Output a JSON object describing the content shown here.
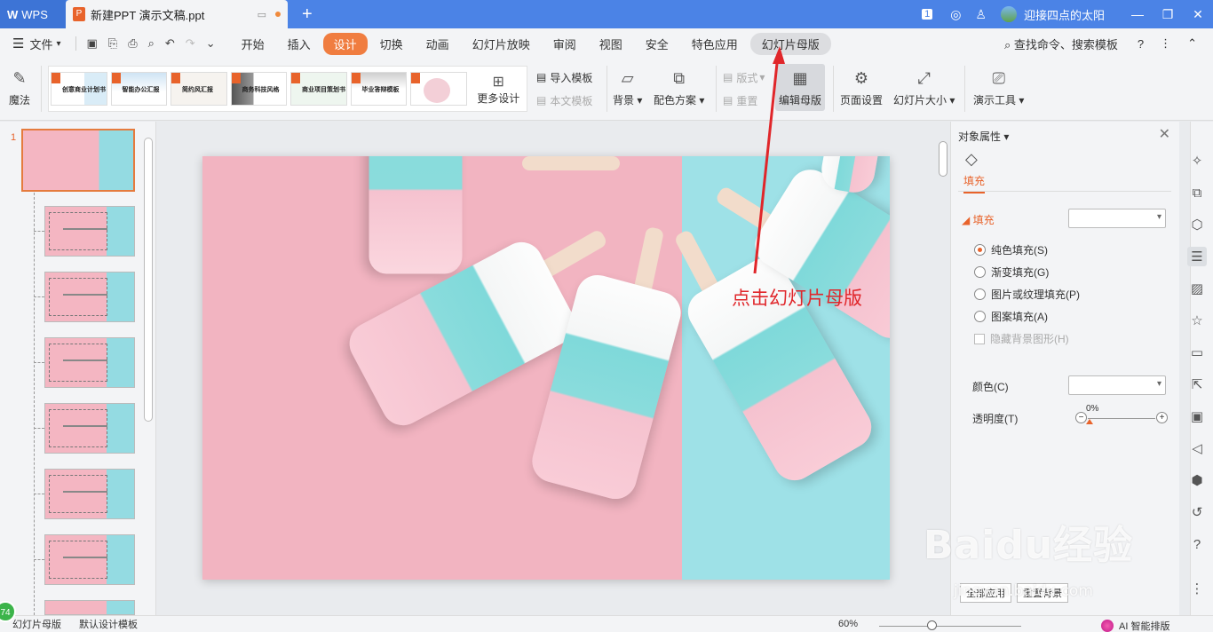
{
  "titlebar": {
    "app_name": "WPS",
    "doc_tab": "新建PPT 演示文稿.ppt",
    "new_tab": "+",
    "window_count": "1",
    "user_name": "迎接四点的太阳"
  },
  "menubar": {
    "file": "文件",
    "tabs": [
      "开始",
      "插入",
      "设计",
      "切换",
      "动画",
      "幻灯片放映",
      "审阅",
      "视图",
      "安全",
      "特色应用",
      "幻灯片母版"
    ],
    "active_tab": "设计",
    "search": "查找命令、搜索模板"
  },
  "ribbon": {
    "magic": "魔法",
    "templates": [
      "创意商业计划书",
      "智能办公汇报",
      "简约风汇报",
      "商务科技风格",
      "商业项目策划书",
      "毕业答辩模板"
    ],
    "more_design": "更多设计",
    "import_template": "导入模板",
    "this_template": "本文模板",
    "background": "背景",
    "color_scheme": "配色方案",
    "layout": "版式",
    "reset": "重置",
    "edit_master": "编辑母版",
    "page_setup": "页面设置",
    "slide_size": "幻灯片大小",
    "present_tools": "演示工具"
  },
  "thumbnails": {
    "slide_number": "1"
  },
  "canvas": {
    "annotation": "点击幻灯片母版"
  },
  "panel": {
    "title": "对象属性",
    "tab_fill": "填充",
    "section_fill": "填充",
    "options": [
      "纯色填充(S)",
      "渐变填充(G)",
      "图片或纹理填充(P)",
      "图案填充(A)"
    ],
    "selected_option": "纯色填充(S)",
    "hide_bg": "隐藏背景图形(H)",
    "color_label": "颜色(C)",
    "transparency_label": "透明度(T)",
    "transparency_value": "0%",
    "apply_all": "全部应用",
    "reset_bg": "重置背景"
  },
  "statusbar": {
    "left1": "幻灯片母版",
    "left2": "默认设计模板",
    "zoom": "60%",
    "ai": "AI 智能排版",
    "badge": "74"
  },
  "watermark": {
    "brand": "Baidu经验",
    "url": "jingyan.baidu.com"
  },
  "colors": {
    "accent": "#e8632b",
    "title_bar": "#4b83e6",
    "annotation": "#e0262a",
    "slide_pink": "#f2b4c1",
    "slide_blue": "#9ee1e7"
  }
}
